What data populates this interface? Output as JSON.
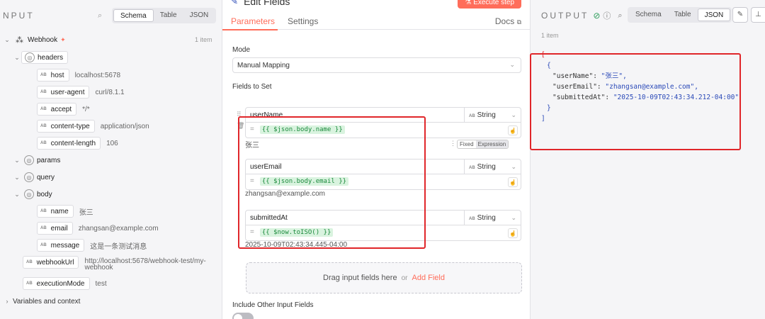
{
  "input": {
    "title": "NPUT",
    "view_tabs": [
      "Schema",
      "Table",
      "JSON"
    ],
    "active_view": "Schema",
    "node": {
      "name": "Webhook",
      "badge": "✦",
      "count": "1 item"
    },
    "headers_label": "headers",
    "headers": [
      {
        "key": "host",
        "value": "localhost:5678"
      },
      {
        "key": "user-agent",
        "value": "curl/8.1.1"
      },
      {
        "key": "accept",
        "value": "*/*"
      },
      {
        "key": "content-type",
        "value": "application/json"
      },
      {
        "key": "content-length",
        "value": "106"
      }
    ],
    "params_label": "params",
    "query_label": "query",
    "body_label": "body",
    "body": [
      {
        "key": "name",
        "value": "张三"
      },
      {
        "key": "email",
        "value": "zhangsan@example.com"
      },
      {
        "key": "message",
        "value": "这是一条测试消息"
      }
    ],
    "webhookUrl": {
      "key": "webhookUrl",
      "value_line1": "http://localhost:5678/webhook-test/my-",
      "value_line2": "webhook"
    },
    "executionMode": {
      "key": "executionMode",
      "value": "test"
    },
    "variables_label": "Variables and context",
    "type_badge": "AB"
  },
  "edit": {
    "title": "Edit Fields",
    "execute_label": "Execute step",
    "tabs": [
      "Parameters",
      "Settings"
    ],
    "docs_label": "Docs",
    "mode_label": "Mode",
    "mode_value": "Manual Mapping",
    "fields_label": "Fields to Set",
    "fields": [
      {
        "name": "userName",
        "type": "String",
        "expression": "{{ $json.body.name }}",
        "result": "张三"
      },
      {
        "name": "userEmail",
        "type": "String",
        "expression": "{{ $json.body.email }}",
        "result": "zhangsan@example.com"
      },
      {
        "name": "submittedAt",
        "type": "String",
        "expression": "{{ $now.toISO() }}",
        "result": "2025-10-09T02:43:34.445-04:00"
      }
    ],
    "fixed_label": "Fixed",
    "expression_label": "Expression",
    "drop_text": "Drag input fields here",
    "or_text": "or",
    "add_field_label": "Add Field",
    "include_label": "Include Other Input Fields"
  },
  "output": {
    "title": "OUTPUT",
    "view_tabs": [
      "Schema",
      "Table",
      "JSON"
    ],
    "active_view": "JSON",
    "count": "1 item",
    "json": {
      "open_bracket": "[",
      "open_brace": "{",
      "rows": [
        {
          "key": "\"userName\"",
          "value": "\"张三\","
        },
        {
          "key": "\"userEmail\"",
          "value": "\"zhangsan@example.com\","
        },
        {
          "key": "\"submittedAt\"",
          "value": "\"2025-10-09T02:43:34.212-04:00\""
        }
      ],
      "close_brace": "}",
      "close_bracket": "]"
    }
  },
  "colors": {
    "accent": "#ff6d5a",
    "highlight_box": "#e0262a",
    "json_string": "#2b4ab8",
    "expr_bg": "#d9f3df"
  }
}
